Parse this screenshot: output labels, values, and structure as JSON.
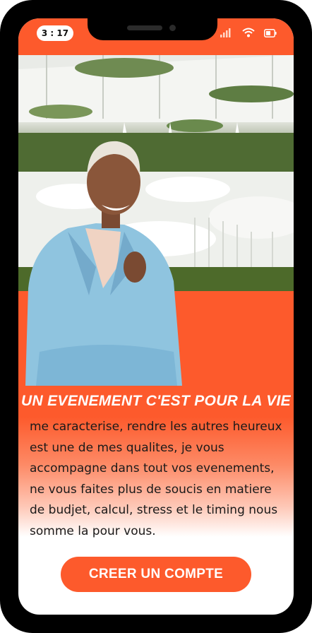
{
  "status_bar": {
    "time": "3 : 17"
  },
  "hero": {
    "heading": "UN EVENEMENT C'EST POUR LA VIE"
  },
  "description": "me caracterise, rendre les autres heureux est une de mes qualites, je vous accompagne dans tout vos evenements, ne vous faites plus de soucis en matiere de budjet, calcul, stress et le timing nous somme la pour vous.",
  "cta": {
    "label": "CREER UN COMPTE"
  },
  "colors": {
    "accent": "#FD5A2C",
    "frame": "#000000",
    "text": "#1a1a1a"
  },
  "icons": [
    "signal-icon",
    "wifi-icon",
    "battery-icon"
  ]
}
